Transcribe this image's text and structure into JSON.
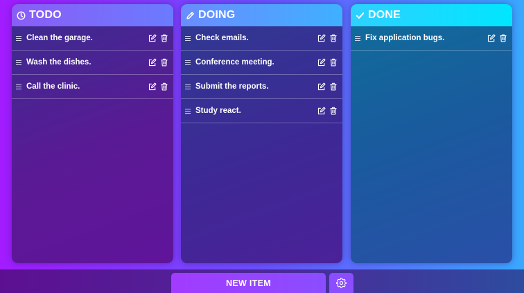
{
  "columns": [
    {
      "id": "todo",
      "title": "TODO",
      "icon": "clock-icon",
      "items": [
        {
          "label": "Clean the garage."
        },
        {
          "label": "Wash the dishes."
        },
        {
          "label": "Call the clinic."
        }
      ]
    },
    {
      "id": "doing",
      "title": "DOING",
      "icon": "pencil-icon",
      "items": [
        {
          "label": "Check emails."
        },
        {
          "label": "Conference meeting."
        },
        {
          "label": "Submit the reports."
        },
        {
          "label": "Study react."
        }
      ]
    },
    {
      "id": "done",
      "title": "DONE",
      "icon": "check-icon",
      "items": [
        {
          "label": "Fix application bugs."
        }
      ]
    }
  ],
  "footer": {
    "new_item_label": "NEW ITEM",
    "settings_icon": "gear-icon"
  },
  "colors": {
    "background_left": "#a21cff",
    "background_right": "#3aa8ff",
    "todo_header": "#8b5cf6",
    "doing_header": "#3fb0ff",
    "done_header": "#00e6ff",
    "button": "#a23bff"
  }
}
